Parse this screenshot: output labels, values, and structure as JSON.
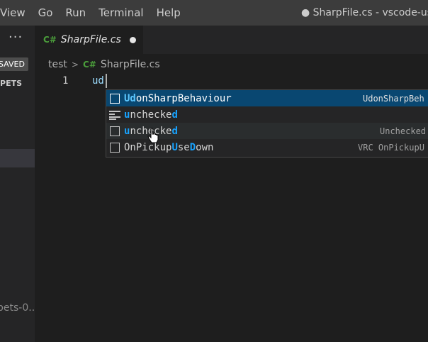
{
  "menu": {
    "items": [
      "View",
      "Go",
      "Run",
      "Terminal",
      "Help"
    ],
    "window_title": "● SharpFile.cs - vscode-usha"
  },
  "sidebar": {
    "more_label": "···",
    "saved_badge": "SAVED",
    "section_header": "PPETS",
    "footer_text": "pets-0...."
  },
  "tab": {
    "lang_icon": "C#",
    "label": "SharpFile.cs"
  },
  "breadcrumb": {
    "folder": "test",
    "separator": ">",
    "lang_icon": "C#",
    "file": "SharpFile.cs"
  },
  "editor": {
    "line_number": "1",
    "code": "ud"
  },
  "suggestions": [
    {
      "icon": "class-icon",
      "label_parts": [
        {
          "t": "Ud",
          "hl": true
        },
        {
          "t": "onSharpBehaviour",
          "hl": false
        }
      ],
      "detail": "UdonSharpBeh"
    },
    {
      "icon": "snippet-icon",
      "label_parts": [
        {
          "t": "u",
          "hl": true
        },
        {
          "t": "nchecke",
          "hl": false
        },
        {
          "t": "d",
          "hl": true
        }
      ],
      "detail": ""
    },
    {
      "icon": "keyword-icon",
      "label_parts": [
        {
          "t": "u",
          "hl": true
        },
        {
          "t": "nchecke",
          "hl": false
        },
        {
          "t": "d",
          "hl": true
        }
      ],
      "detail": "Unchecked"
    },
    {
      "icon": "method-icon",
      "label_parts": [
        {
          "t": "OnPickup",
          "hl": false
        },
        {
          "t": "U",
          "hl": true
        },
        {
          "t": "se",
          "hl": false
        },
        {
          "t": "D",
          "hl": true
        },
        {
          "t": "own",
          "hl": false
        }
      ],
      "detail": "VRC OnPickupU"
    }
  ],
  "colors": {
    "accent_highlight": "#18a3ff",
    "selection": "#094771",
    "csharp_green": "#4b9e3b"
  }
}
